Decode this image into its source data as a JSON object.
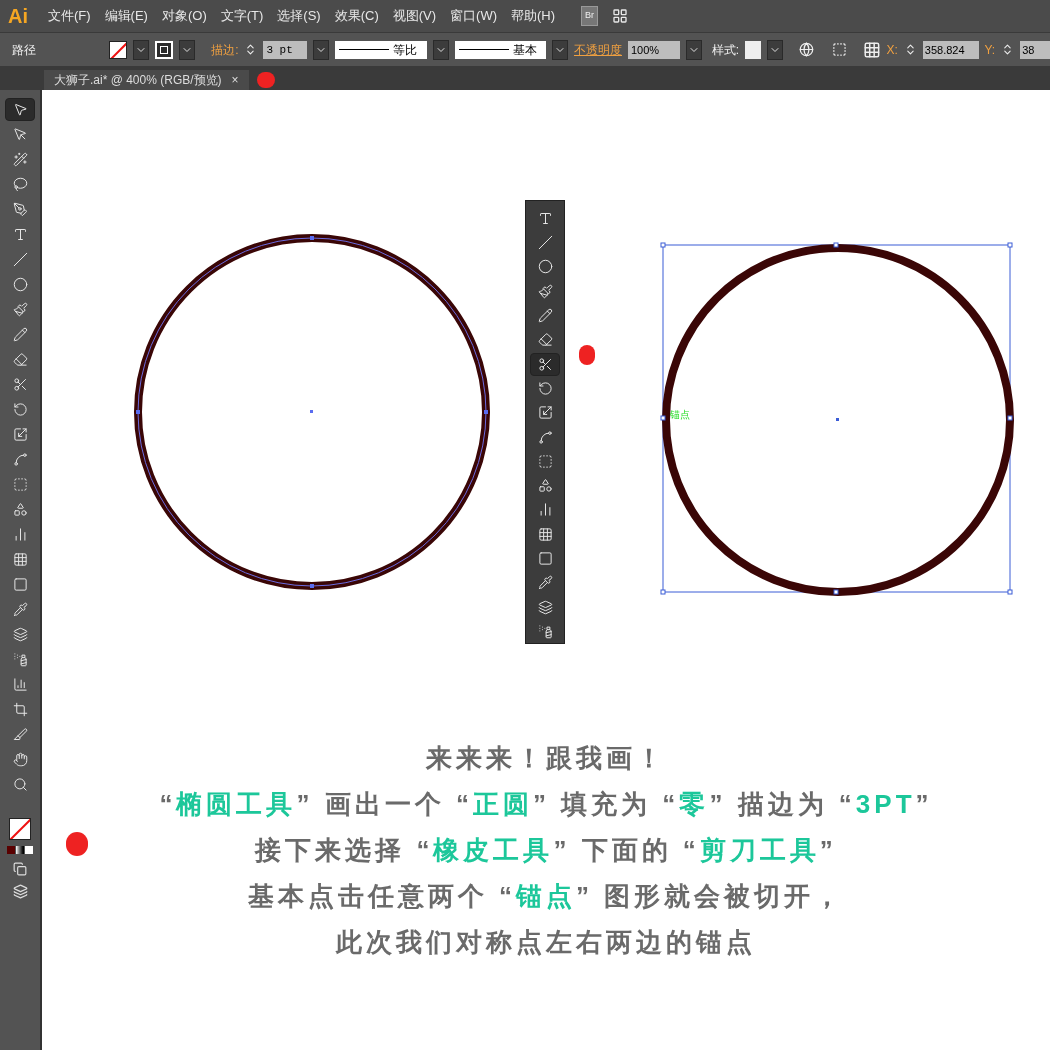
{
  "menu_bar": {
    "logo": "Ai",
    "items": [
      "文件(F)",
      "编辑(E)",
      "对象(O)",
      "文字(T)",
      "选择(S)",
      "效果(C)",
      "视图(V)",
      "窗口(W)",
      "帮助(H)"
    ],
    "bridge_button": "Br"
  },
  "control_bar": {
    "object_type": "路径",
    "stroke_label": "描边:",
    "stroke_weight": "3 pt",
    "profile": "等比",
    "brush": "基本",
    "opacity_label": "不透明度",
    "opacity": "100%",
    "style_label": "样式:",
    "x_label": "X:",
    "x_value": "358.824",
    "y_label": "Y:",
    "y_value": "38"
  },
  "document_tab": {
    "title": "大狮子.ai* @ 400% (RGB/预览)",
    "close": "×"
  },
  "tools": [
    {
      "kind": "selection",
      "selected": true
    },
    {
      "kind": "direct",
      "selected": false
    },
    {
      "kind": "wand",
      "selected": false
    },
    {
      "kind": "lasso",
      "selected": false
    },
    {
      "kind": "pen",
      "selected": false
    },
    {
      "kind": "type",
      "selected": false
    },
    {
      "kind": "line",
      "selected": false
    },
    {
      "kind": "ellipse",
      "selected": false
    },
    {
      "kind": "brush",
      "selected": false
    },
    {
      "kind": "pencil",
      "selected": false
    },
    {
      "kind": "eraser",
      "selected": false
    },
    {
      "kind": "scissors",
      "selected": false
    },
    {
      "kind": "rotate",
      "selected": false
    },
    {
      "kind": "scale",
      "selected": false
    },
    {
      "kind": "warp",
      "selected": false
    },
    {
      "kind": "transform",
      "selected": false
    },
    {
      "kind": "shape",
      "selected": false
    },
    {
      "kind": "graph",
      "selected": false
    },
    {
      "kind": "mesh",
      "selected": false
    },
    {
      "kind": "gradient",
      "selected": false
    },
    {
      "kind": "eyedropper",
      "selected": false
    },
    {
      "kind": "blend",
      "selected": false
    },
    {
      "kind": "spray",
      "selected": false
    },
    {
      "kind": "column",
      "selected": false
    },
    {
      "kind": "artboard",
      "selected": false
    },
    {
      "kind": "slice",
      "selected": false
    },
    {
      "kind": "hand",
      "selected": false
    },
    {
      "kind": "zoom",
      "selected": false
    }
  ],
  "floating_tools": [
    {
      "kind": "type",
      "selected": false
    },
    {
      "kind": "line",
      "selected": false
    },
    {
      "kind": "ellipse",
      "selected": false
    },
    {
      "kind": "brush",
      "selected": false
    },
    {
      "kind": "pencil",
      "selected": false
    },
    {
      "kind": "eraser",
      "selected": false
    },
    {
      "kind": "scissors",
      "selected": true
    },
    {
      "kind": "rotate",
      "selected": false
    },
    {
      "kind": "scale",
      "selected": false
    },
    {
      "kind": "warp",
      "selected": false
    },
    {
      "kind": "transform",
      "selected": false
    },
    {
      "kind": "shape",
      "selected": false
    },
    {
      "kind": "graph",
      "selected": false
    },
    {
      "kind": "mesh",
      "selected": false
    },
    {
      "kind": "gradient",
      "selected": false
    },
    {
      "kind": "eyedropper",
      "selected": false
    },
    {
      "kind": "blend",
      "selected": false
    },
    {
      "kind": "spray",
      "selected": false
    }
  ],
  "canvas": {
    "anchor_label": "锚点",
    "caption": [
      [
        {
          "text": "来来来！跟我画！",
          "highlight": false
        }
      ],
      [
        {
          "text": "“",
          "highlight": false
        },
        {
          "text": "椭圆工具",
          "highlight": true
        },
        {
          "text": "” 画出一个 “",
          "highlight": false
        },
        {
          "text": "正圆",
          "highlight": true
        },
        {
          "text": "” 填充为 “",
          "highlight": false
        },
        {
          "text": "零",
          "highlight": true
        },
        {
          "text": "” 描边为 “",
          "highlight": false
        },
        {
          "text": "3PT",
          "highlight": true
        },
        {
          "text": "”",
          "highlight": false
        }
      ],
      [
        {
          "text": "接下来选择 “",
          "highlight": false
        },
        {
          "text": "橡皮工具",
          "highlight": true
        },
        {
          "text": "” 下面的 “",
          "highlight": false
        },
        {
          "text": "剪刀工具",
          "highlight": true
        },
        {
          "text": "”",
          "highlight": false
        }
      ],
      [
        {
          "text": "基本点击任意两个 “",
          "highlight": false
        },
        {
          "text": "锚点",
          "highlight": true
        },
        {
          "text": "” 图形就会被切开，",
          "highlight": false
        }
      ],
      [
        {
          "text": "此次我们对称点左右两边的锚点",
          "highlight": false
        }
      ]
    ]
  }
}
